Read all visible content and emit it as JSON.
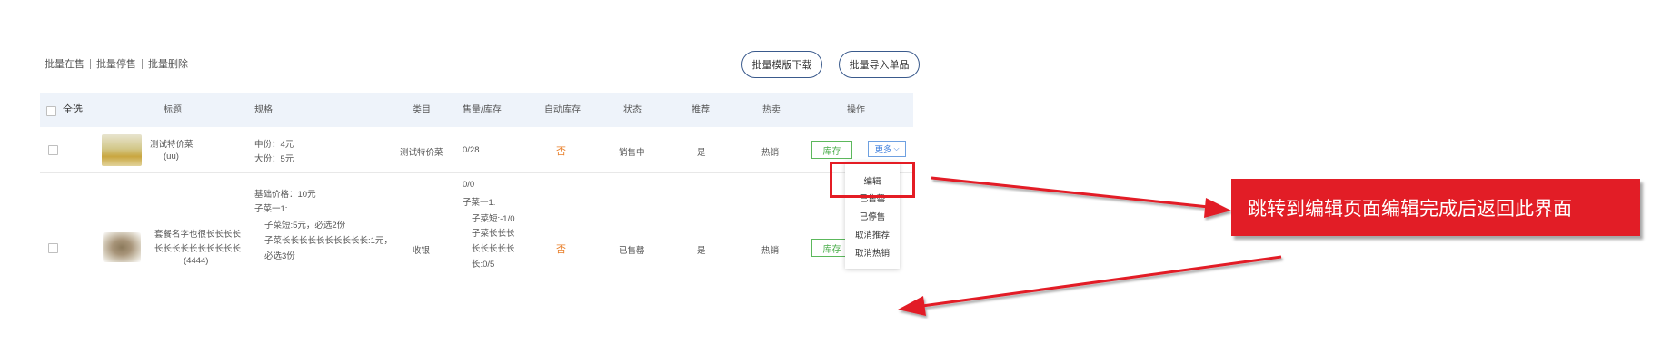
{
  "toolbar": {
    "bulk_on_sale": "批量在售",
    "bulk_stop_sale": "批量停售",
    "bulk_delete": "批量删除",
    "template_download": "批量模版下载",
    "import_single": "批量导入单品"
  },
  "table": {
    "headers": {
      "select_all": "全选",
      "title": "标题",
      "spec": "规格",
      "category": "类目",
      "sales_stock": "售量/库存",
      "auto_stock": "自动库存",
      "status": "状态",
      "recommend": "推荐",
      "hot": "热卖",
      "actions": "操作"
    },
    "rows": [
      {
        "title_line1": "测试特价菜",
        "title_line2": "(uu)",
        "spec_lines": [
          "中份：4元",
          "大份：5元"
        ],
        "category": "测试特价菜",
        "sales_stock": "0/28",
        "auto_stock": "否",
        "status": "销售中",
        "recommend": "是",
        "hot": "热销",
        "stock_btn": "库存",
        "more_btn": "更多"
      },
      {
        "title_line1": "套餐名字也很长长长长",
        "title_line2": "长长长长长长长长长长",
        "title_line3": "(4444)",
        "spec_lines": [
          "基础价格：10元",
          "子菜一1:",
          "子菜短:5元，必选2份",
          "子菜长长长长长长长长长长:1元，",
          "必选3份"
        ],
        "sales_stock_lines": [
          "0/0",
          "子菜一1:",
          "子菜短:-1/0",
          "子菜长长长",
          "长长长长长",
          "长:0/5"
        ],
        "category": "收银",
        "auto_stock": "否",
        "status": "已售罄",
        "recommend": "是",
        "hot": "热销",
        "stock_btn": "库存"
      }
    ]
  },
  "dropdown": {
    "items": [
      "编辑",
      "已售罄",
      "已停售",
      "取消推荐",
      "取消热销"
    ]
  },
  "annotation": {
    "callout_text": "跳转到编辑页面编辑完成后返回此界面",
    "accent_color": "#e21d26"
  }
}
